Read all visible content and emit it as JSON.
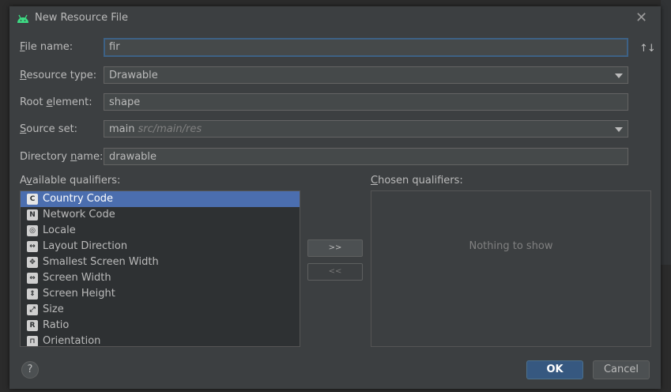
{
  "colors": {
    "dialog_bg": "#3c3f41",
    "selection": "#4b6eaf",
    "ok_button": "#365880",
    "android_green": "#3ddc84"
  },
  "dialog": {
    "title": "New Resource File",
    "title_icon": "android-icon",
    "close_glyph": "✕"
  },
  "form": {
    "file_name": {
      "label_mnemonic": "F",
      "label_rest": "ile name:",
      "value": "fir"
    },
    "resource_type": {
      "label_mnemonic": "R",
      "label_rest": "esource type:",
      "value": "Drawable"
    },
    "root_element": {
      "label_pre": "Root ",
      "label_mnemonic": "e",
      "label_rest": "lement:",
      "value": "shape"
    },
    "source_set": {
      "label_mnemonic": "S",
      "label_rest": "ource set:",
      "value": "main",
      "hint": "src/main/res"
    },
    "directory_name": {
      "label_pre": "Directory ",
      "label_mnemonic": "n",
      "label_rest": "ame:",
      "value": "drawable"
    },
    "sort_glyph": "↑↓"
  },
  "available_qualifiers": {
    "label_pre": "A",
    "label_mnemonic": "v",
    "label_rest": "ailable qualifiers:",
    "items": [
      {
        "label": "Country Code",
        "icon": "country-code-icon",
        "glyph": "C"
      },
      {
        "label": "Network Code",
        "icon": "network-code-icon",
        "glyph": "N"
      },
      {
        "label": "Locale",
        "icon": "globe-icon",
        "glyph": "◎"
      },
      {
        "label": "Layout Direction",
        "icon": "layout-direction-icon",
        "glyph": "↔"
      },
      {
        "label": "Smallest Screen Width",
        "icon": "smallest-width-icon",
        "glyph": "✥"
      },
      {
        "label": "Screen Width",
        "icon": "screen-width-icon",
        "glyph": "⇔"
      },
      {
        "label": "Screen Height",
        "icon": "screen-height-icon",
        "glyph": "⇕"
      },
      {
        "label": "Size",
        "icon": "size-icon",
        "glyph": "⤢"
      },
      {
        "label": "Ratio",
        "icon": "ratio-icon",
        "glyph": "R"
      },
      {
        "label": "Orientation",
        "icon": "orientation-icon",
        "glyph": "⊓"
      }
    ],
    "selected_index": 0
  },
  "buttons": {
    "add": ">>",
    "remove": "<<",
    "help": "?",
    "ok": "OK",
    "cancel": "Cancel"
  },
  "chosen_qualifiers": {
    "label_mnemonic": "C",
    "label_rest": "hosen qualifiers:",
    "empty_text": "Nothing to show"
  }
}
